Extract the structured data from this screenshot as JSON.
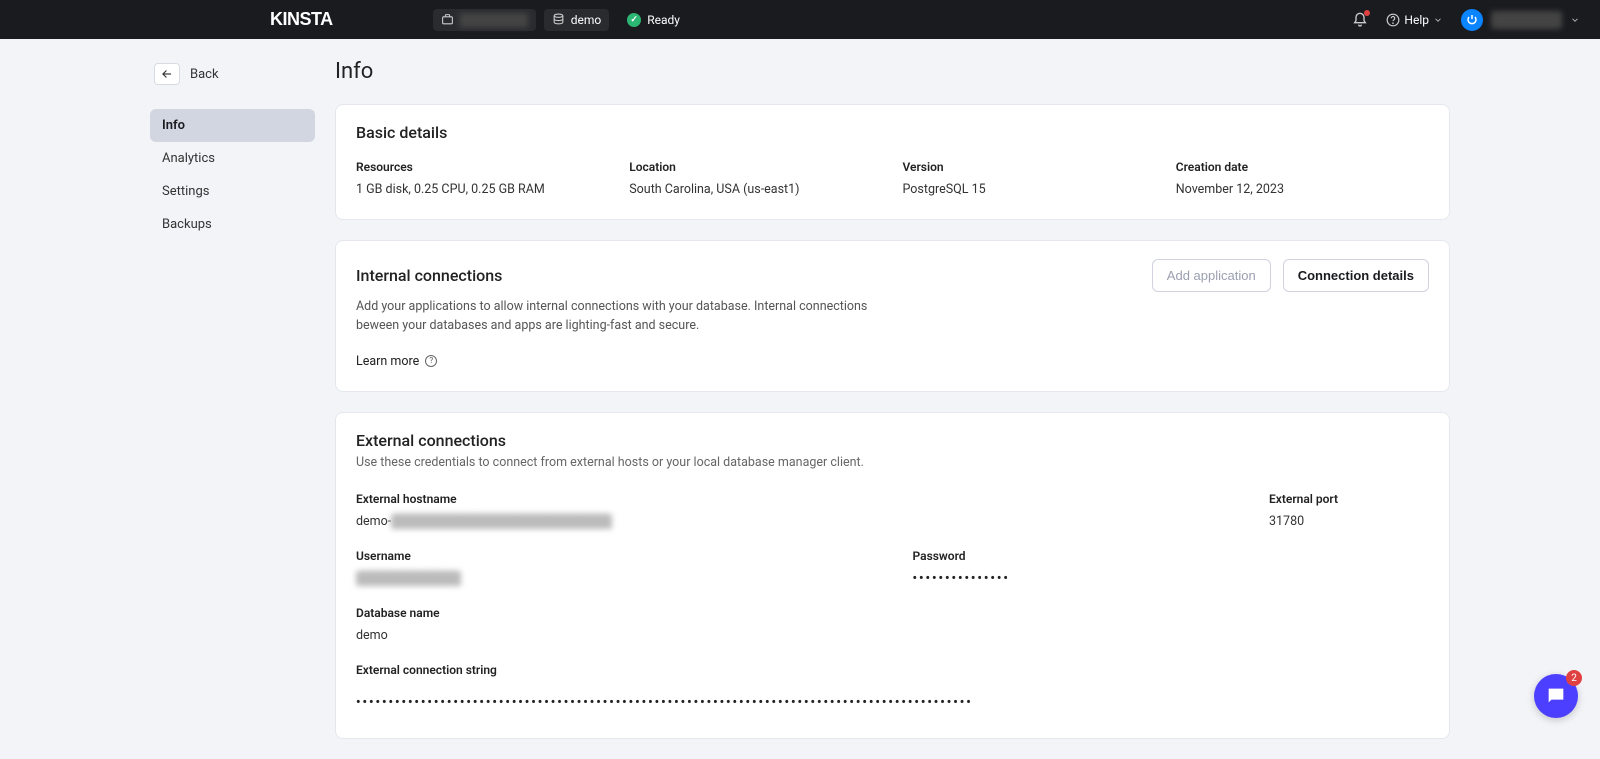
{
  "header": {
    "brand": "KINSTA",
    "workspaceRedacted": "████████",
    "dbName": "demo",
    "statusLabel": "Ready",
    "helpLabel": "Help",
    "userRedacted": "██████"
  },
  "sidebar": {
    "backLabel": "Back",
    "items": [
      {
        "label": "Info",
        "active": true
      },
      {
        "label": "Analytics",
        "active": false
      },
      {
        "label": "Settings",
        "active": false
      },
      {
        "label": "Backups",
        "active": false
      }
    ]
  },
  "page": {
    "title": "Info"
  },
  "basic": {
    "title": "Basic details",
    "resourcesLabel": "Resources",
    "resourcesValue": "1 GB disk, 0.25 CPU, 0.25 GB RAM",
    "locationLabel": "Location",
    "locationValue": "South Carolina, USA (us-east1)",
    "versionLabel": "Version",
    "versionValue": "PostgreSQL 15",
    "createdLabel": "Creation date",
    "createdValue": "November 12, 2023"
  },
  "internal": {
    "title": "Internal connections",
    "description": "Add your applications to allow internal connections with your database. Internal connections beween your databases and apps are lighting-fast and secure.",
    "addAppLabel": "Add application",
    "connDetailsLabel": "Connection details",
    "learnMore": "Learn more"
  },
  "external": {
    "title": "External connections",
    "description": "Use these credentials to connect from external hosts or your local database manager client.",
    "hostLabel": "External hostname",
    "hostPrefix": "demo-",
    "hostRedacted": "████████████████████████",
    "portLabel": "External port",
    "portValue": "31780",
    "userLabel": "Username",
    "userRedacted": "███████████",
    "passLabel": "Password",
    "passMasked": "•••••••••••••••",
    "dbnameLabel": "Database name",
    "dbnameValue": "demo",
    "connstrLabel": "External connection string",
    "connstrMasked": "•••••••••••••••••••••••••••••••••••••••••••••••••••••••••••••••••••••••••••••••••••••••••••••••"
  },
  "chat": {
    "badge": "2"
  }
}
